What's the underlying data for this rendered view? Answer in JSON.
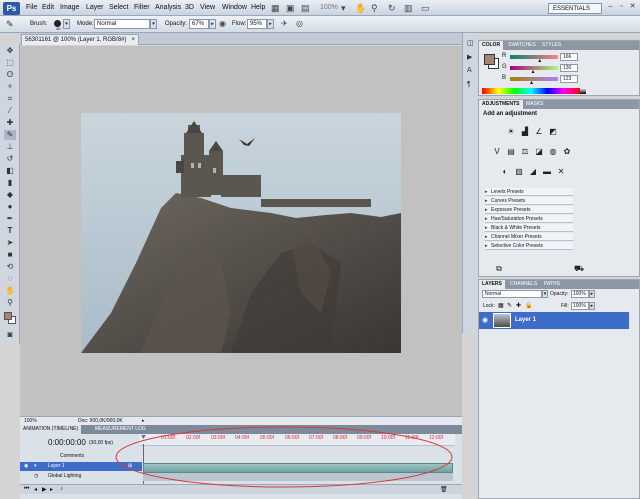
{
  "app": {
    "logo": "Ps"
  },
  "menu": [
    "File",
    "Edit",
    "Image",
    "Layer",
    "Select",
    "Filter",
    "Analysis",
    "3D",
    "View",
    "Window",
    "Help"
  ],
  "menubar_right": {
    "zoom": "100%",
    "workspace": "ESSENTIALS"
  },
  "options": {
    "brush_label": "Brush:",
    "brush_size": "40",
    "mode_label": "Mode:",
    "mode_value": "Normal",
    "opacity_label": "Opacity:",
    "opacity_value": "67%",
    "flow_label": "Flow:",
    "flow_value": "95%"
  },
  "document": {
    "tab_title": "56301161 @ 100% (Layer 1, RGB/8#)",
    "status_zoom": "100%",
    "status_doc": "Doc: 900,0K/900,0K"
  },
  "timeline": {
    "tab_animation": "ANIMATION (TIMELINE)",
    "tab_measurement": "MEASUREMENT LOG",
    "timecode": "0:00:00:00",
    "fps": "(30,00 fps)",
    "ticks": [
      "01:00f",
      "02:00f",
      "03:00f",
      "04:00f",
      "05:00f",
      "06:00f",
      "07:00f",
      "08:00f",
      "09:00f",
      "10:00f",
      "11:00f",
      "12:00f"
    ],
    "row_comments": "Comments",
    "row_layer": "Layer 1",
    "row_global_lighting": "Global Lighting"
  },
  "color_panel": {
    "tabs": [
      "COLOR",
      "SWATCHES",
      "STYLES"
    ],
    "r_label": "R",
    "g_label": "G",
    "b_label": "B",
    "r_value": "166",
    "g_value": "130",
    "b_value": "123",
    "r_fraction": 0.65,
    "g_fraction": 0.51,
    "b_fraction": 0.48,
    "foreground_color": "#a6827b"
  },
  "adjustments_panel": {
    "tabs": [
      "ADJUSTMENTS",
      "MASKS"
    ],
    "heading": "Add an adjustment",
    "presets": [
      "Levels Presets",
      "Curves Presets",
      "Exposure Presets",
      "Hue/Saturation Presets",
      "Black & White Presets",
      "Channel Mixer Presets",
      "Selective Color Presets"
    ]
  },
  "layers_panel": {
    "tabs": [
      "LAYERS",
      "CHANNELS",
      "PATHS"
    ],
    "blend_mode": "Normal",
    "opacity_label": "Opacity:",
    "opacity_value": "100%",
    "lock_label": "Lock:",
    "fill_label": "Fill:",
    "fill_value": "100%",
    "layer_name": "Layer 1"
  }
}
